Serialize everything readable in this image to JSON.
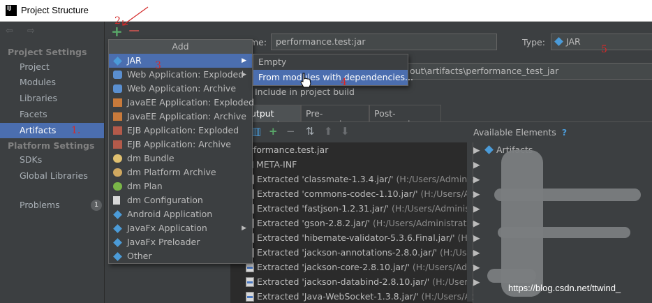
{
  "window": {
    "app_icon": "IJ",
    "title": "Project Structure"
  },
  "nav": {
    "back_forward": "⇦ ⇨",
    "project_settings_header": "Project Settings",
    "project_settings_items": [
      "Project",
      "Modules",
      "Libraries",
      "Facets",
      "Artifacts"
    ],
    "platform_settings_header": "Platform Settings",
    "platform_settings_items": [
      "SDKs",
      "Global Libraries"
    ],
    "problems_label": "Problems",
    "problems_count": "1",
    "selected_item": "Artifacts"
  },
  "toolbar": {
    "add_glyph": "+",
    "remove_glyph": "−"
  },
  "artifact": {
    "name_label": "me:",
    "name_value": "performance.test:jar",
    "type_label": "Type:",
    "type_value": "JAR",
    "output_dir_value": "out\\artifacts\\performance_test_jar",
    "include_in_build_label": "Include in project build",
    "tabs": [
      "utput Layout",
      "Pre-processing",
      "Post-processing"
    ],
    "active_tab": "utput Layout"
  },
  "output_tree": {
    "root": "erformance.test.jar",
    "folder": "META-INF",
    "rows": [
      {
        "label": "Extracted 'classmate-1.3.4.jar/'",
        "path": " (H:/Users/Administrat"
      },
      {
        "label": "Extracted 'commons-codec-1.10.jar/'",
        "path": " (H:/Users/Adm"
      },
      {
        "label": "Extracted 'fastjson-1.2.31.jar/'",
        "path": " (H:/Users/Administrato"
      },
      {
        "label": "Extracted 'gson-2.8.2.jar/'",
        "path": " (H:/Users/Administrator/.n"
      },
      {
        "label": "Extracted 'hibernate-validator-5.3.6.Final.jar/'",
        "path": " (H:/Use"
      },
      {
        "label": "Extracted 'jackson-annotations-2.8.0.jar/'",
        "path": " (H:/Users/A"
      },
      {
        "label": "Extracted 'jackson-core-2.8.10.jar/'",
        "path": " (H:/Users/Admi"
      },
      {
        "label": "Extracted 'jackson-databind-2.8.10.jar/'",
        "path": " (H:/Users/Ad"
      },
      {
        "label": "Extracted 'Java-WebSocket-1.3.8.jar/'",
        "path": " (H:/Users/Ad"
      }
    ]
  },
  "available_elements": {
    "header": "Available Elements",
    "help_glyph": "?",
    "first_row": "Artifacts"
  },
  "add_menu": {
    "header": "Add",
    "items": [
      {
        "label": "JAR",
        "icon": "jar-icon",
        "submenu": true
      },
      {
        "label": "Web Application: Exploded",
        "icon": "web-app-icon",
        "submenu": true
      },
      {
        "label": "Web Application: Archive",
        "icon": "web-app-icon",
        "submenu": false
      },
      {
        "label": "JavaEE Application: Exploded",
        "icon": "javaee-icon",
        "submenu": false
      },
      {
        "label": "JavaEE Application: Archive",
        "icon": "javaee-icon",
        "submenu": false
      },
      {
        "label": "EJB Application: Exploded",
        "icon": "ejb-icon",
        "submenu": false
      },
      {
        "label": "EJB Application: Archive",
        "icon": "ejb-icon",
        "submenu": false
      },
      {
        "label": "dm Bundle",
        "icon": "dm-bundle-icon",
        "submenu": false
      },
      {
        "label": "dm Platform Archive",
        "icon": "dm-platform-icon",
        "submenu": false
      },
      {
        "label": "dm Plan",
        "icon": "dm-plan-icon",
        "submenu": false
      },
      {
        "label": "dm Configuration",
        "icon": "dm-config-icon",
        "submenu": false
      },
      {
        "label": "Android Application",
        "icon": "android-icon",
        "submenu": false
      },
      {
        "label": "JavaFx Application",
        "icon": "javafx-icon",
        "submenu": true
      },
      {
        "label": "JavaFx Preloader",
        "icon": "javafx-icon",
        "submenu": false
      },
      {
        "label": "Other",
        "icon": "other-icon",
        "submenu": false
      }
    ],
    "selected": "JAR",
    "submenu_arrow": "▶"
  },
  "jar_submenu": {
    "items": [
      "Empty",
      "From modules with dependencies..."
    ],
    "hovered": "From modules with dependencies..."
  },
  "annotations": [
    "1.",
    "2",
    "3",
    "4",
    "5"
  ],
  "watermark": "https://blog.csdn.net/ttwind_",
  "colors": {
    "selection": "#4b6eaf",
    "panel_bg": "#3c3f41",
    "annotation_red": "#d42a2a",
    "add_green": "#59a869",
    "remove_red": "#c75450"
  }
}
